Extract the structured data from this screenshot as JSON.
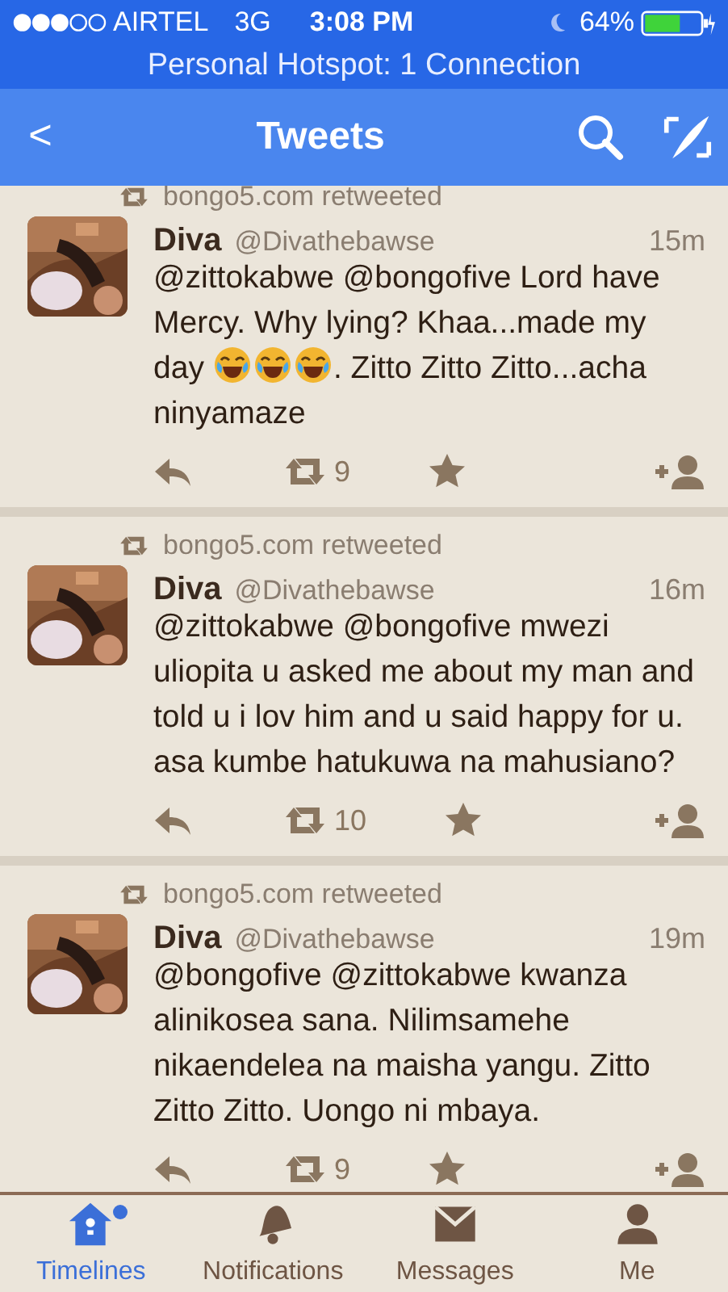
{
  "status_bar": {
    "carrier": "AIRTEL",
    "network": "3G",
    "time": "3:08 PM",
    "battery": "64%"
  },
  "hotspot_banner": "Personal Hotspot: 1 Connection",
  "nav": {
    "back": "<",
    "title": "Tweets"
  },
  "tweets": [
    {
      "retweeted_by": "bongo5.com retweeted",
      "name": "Diva",
      "handle": "@Divathebawse",
      "time": "15m",
      "body": [
        [
          {
            "kind": "text",
            "text": "@zittokabwe @bongofive Lord have Mercy. Why lying? Khaa...made my"
          }
        ],
        [
          {
            "kind": "text",
            "text": "day"
          },
          {
            "kind": "emoji"
          },
          {
            "kind": "emoji"
          },
          {
            "kind": "emoji"
          },
          {
            "kind": "text",
            "text": ". Zitto Zitto Zitto...acha"
          }
        ],
        [
          {
            "kind": "text",
            "text": "ninyamaze"
          }
        ]
      ],
      "retweets": "9"
    },
    {
      "retweeted_by": "bongo5.com retweeted",
      "name": "Diva",
      "handle": "@Divathebawse",
      "time": "16m",
      "body": [
        [
          {
            "kind": "text",
            "text": "@zittokabwe @bongofive mwezi uliopita u asked me about my man and told u i lov him and u said happy for u. asa kumbe hatukuwa na mahusiano?"
          }
        ]
      ],
      "retweets": "10"
    },
    {
      "retweeted_by": "bongo5.com retweeted",
      "name": "Diva",
      "handle": "@Divathebawse",
      "time": "19m",
      "body": [
        [
          {
            "kind": "text",
            "text": "@bongofive @zittokabwe kwanza alinikosea sana. Nilimsamehe nikaendelea na maisha yangu. Zitto Zitto Zitto. Uongo ni mbaya."
          }
        ]
      ],
      "retweets": "9"
    }
  ],
  "tabs": [
    {
      "kind": "home",
      "label": "Timelines",
      "selected": true,
      "dot": true
    },
    {
      "kind": "bell",
      "label": "Notifications",
      "selected": false,
      "dot": false
    },
    {
      "kind": "mail",
      "label": "Messages",
      "selected": false,
      "dot": false
    },
    {
      "kind": "person",
      "label": "Me",
      "selected": false,
      "dot": false
    }
  ]
}
